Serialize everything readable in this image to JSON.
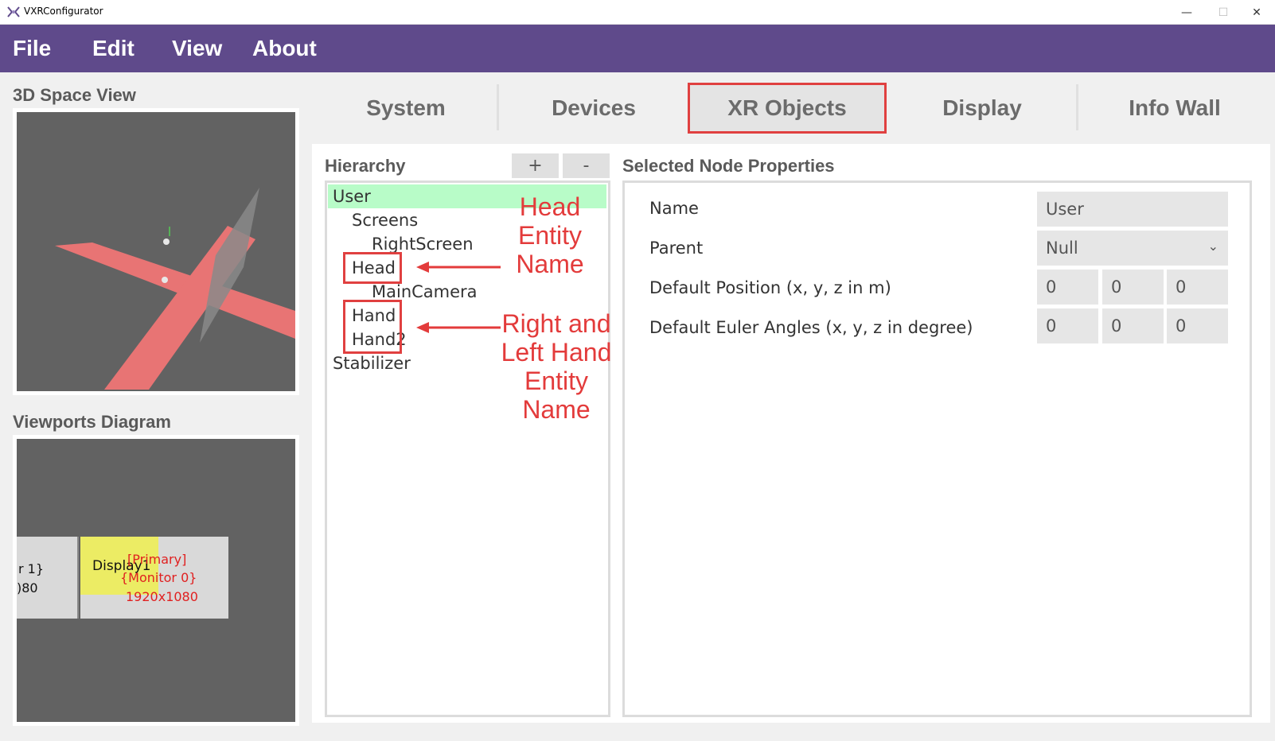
{
  "window": {
    "title": "VXRConfigurator",
    "minimize_glyph": "—",
    "maximize_glyph": "☐",
    "close_glyph": "✕"
  },
  "menu": [
    "File",
    "Edit",
    "View",
    "About"
  ],
  "left": {
    "space_view_title": "3D Space View",
    "viewports_title": "Viewports Diagram",
    "viewport_left_line1": "r 1}",
    "viewport_left_line2": ")80",
    "display_label": "Display1",
    "primary_line1": "[Primary]",
    "primary_line2": "{Monitor 0}",
    "primary_line3": "1920x1080"
  },
  "tabs": [
    "System",
    "Devices",
    "XR Objects",
    "Display",
    "Info Wall"
  ],
  "active_tab": "XR Objects",
  "hierarchy": {
    "title": "Hierarchy",
    "add_label": "+",
    "remove_label": "-",
    "items": [
      "User",
      "Screens",
      "RightScreen",
      "Head",
      "MainCamera",
      "Hand",
      "Hand2",
      "Stabilizer"
    ],
    "selected": "User"
  },
  "annotations": {
    "head": "Head\nEntity\nName",
    "hands": "Right and\nLeft Hand\nEntity\nName"
  },
  "properties": {
    "title": "Selected Node Properties",
    "name_label": "Name",
    "name_value": "User",
    "parent_label": "Parent",
    "parent_value": "Null",
    "position_label": "Default Position (x, y, z in m)",
    "position_values": [
      "0",
      "0",
      "0"
    ],
    "euler_label": "Default Euler Angles (x, y, z in degree)",
    "euler_values": [
      "0",
      "0",
      "0"
    ]
  },
  "colors": {
    "menubar": "#5f4a8b",
    "selected_row": "#b8fcc8",
    "annotation": "#e33b3b",
    "floor_plane": "#e87474",
    "display_highlight": "#ecec64"
  }
}
